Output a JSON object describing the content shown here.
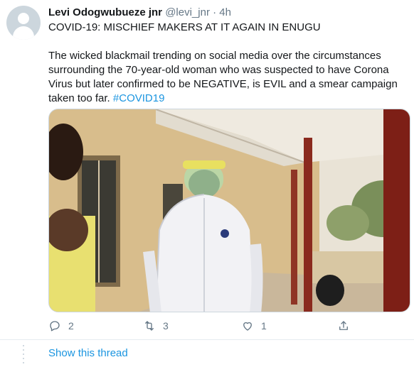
{
  "tweet": {
    "display_name": "Levi Odogwubueze jnr",
    "handle": "@levi_jnr",
    "separator": "·",
    "time": "4h",
    "text_line1": "COVID-19: MISCHIEF MAKERS AT IT AGAIN IN ENUGU",
    "text_para2": "The wicked blackmail trending on social media over the circumstances surrounding the 70-year-old woman who was suspected to have Corona Virus but later confirmed to be NEGATIVE, is EVIL and a smear campaign taken too far.",
    "hashtag": "#COVID19"
  },
  "actions": {
    "reply_count": "2",
    "retweet_count": "3",
    "like_count": "1"
  },
  "thread": {
    "show_thread_label": "Show this thread"
  },
  "colors": {
    "link": "#1b95e0",
    "secondary_text": "#657786",
    "border": "#e6ecf0"
  }
}
